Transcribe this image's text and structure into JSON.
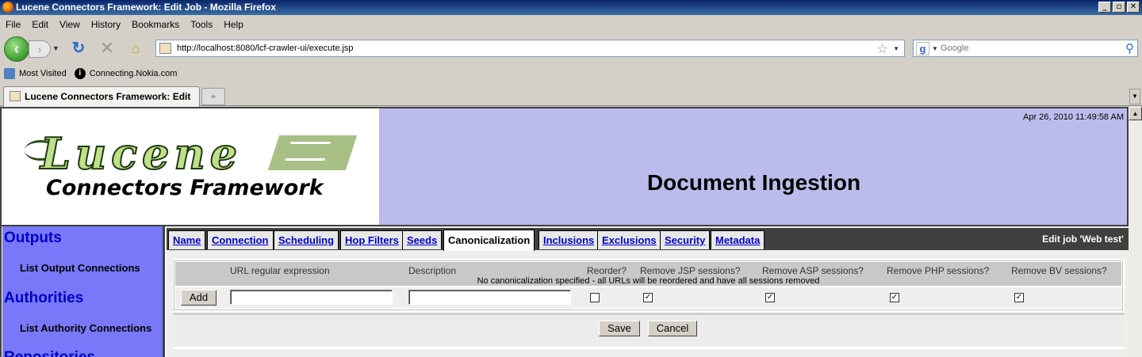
{
  "window": {
    "title": "Lucene Connectors Framework: Edit Job - Mozilla Firefox",
    "minimize": "_",
    "maximize": "▫",
    "close": "✕"
  },
  "menu": [
    "File",
    "Edit",
    "View",
    "History",
    "Bookmarks",
    "Tools",
    "Help"
  ],
  "nav": {
    "url": "http://localhost:8080/lcf-crawler-ui/execute.jsp",
    "search_placeholder": "Google"
  },
  "bookmarks": [
    "Most Visited",
    "Connecting.Nokia.com"
  ],
  "browser_tab": {
    "title": "Lucene Connectors Framework: Edit ..."
  },
  "header": {
    "logo_main": "Lucene",
    "logo_sub": "Connectors Framework",
    "datetime": "Apr 26, 2010 11:49:58 AM",
    "title": "Document Ingestion"
  },
  "sidebar": {
    "sections": [
      {
        "heading": "Outputs",
        "link": "List Output Connections"
      },
      {
        "heading": "Authorities",
        "link": "List Authority Connections"
      },
      {
        "heading": "Repositories"
      }
    ]
  },
  "job_tabs": [
    "Name",
    "Connection",
    "Scheduling",
    "Hop Filters",
    "Seeds",
    "Canonicalization",
    "Inclusions",
    "Exclusions",
    "Security",
    "Metadata"
  ],
  "active_tab": "Canonicalization",
  "edit_job_label": "Edit job 'Web test'",
  "canon_table": {
    "headers": [
      "URL regular expression",
      "Description",
      "Reorder?",
      "Remove JSP sessions?",
      "Remove ASP sessions?",
      "Remove PHP sessions?",
      "Remove BV sessions?"
    ],
    "empty_message": "No canonicalization specified - all URLs will be reordered and have all sessions removed",
    "add_label": "Add",
    "url_regex_value": "",
    "description_value": "",
    "checks": {
      "reorder": false,
      "jsp": true,
      "asp": true,
      "php": true,
      "bv": true
    }
  },
  "buttons": {
    "save": "Save",
    "cancel": "Cancel"
  }
}
